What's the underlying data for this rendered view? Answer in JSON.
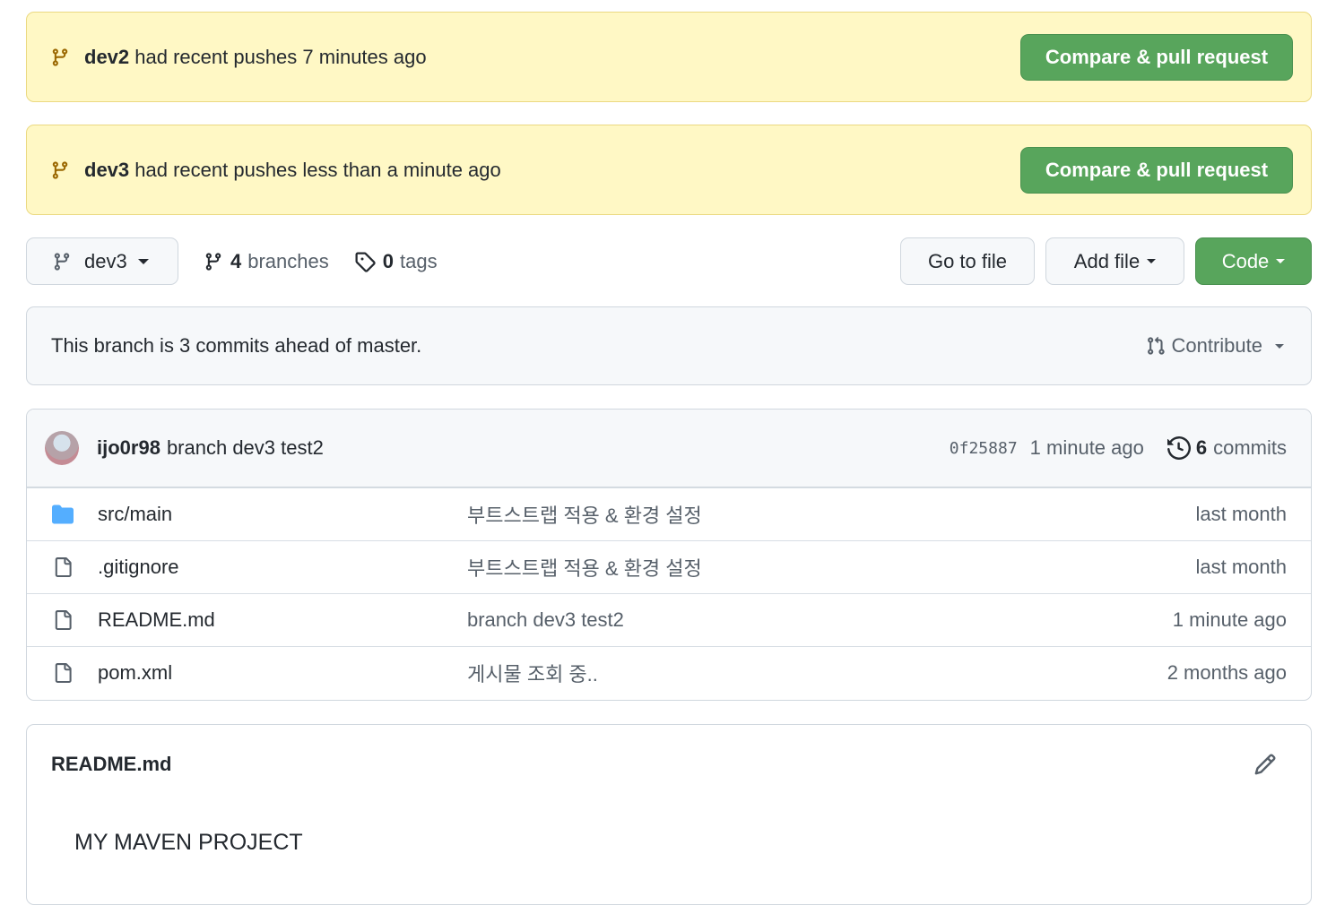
{
  "banners": [
    {
      "branch": "dev2",
      "text": " had recent pushes 7 minutes ago",
      "button": "Compare & pull request"
    },
    {
      "branch": "dev3",
      "text": " had recent pushes less than a minute ago",
      "button": "Compare & pull request"
    }
  ],
  "toolbar": {
    "current_branch": "dev3",
    "branches_count": "4",
    "branches_label": "branches",
    "tags_count": "0",
    "tags_label": "tags",
    "go_to_file": "Go to file",
    "add_file": "Add file",
    "code": "Code"
  },
  "ahead": {
    "text": "This branch is 3 commits ahead of master.",
    "contribute": "Contribute"
  },
  "latest_commit": {
    "author": "ijo0r98",
    "message": "branch dev3 test2",
    "sha": "0f25887",
    "time": "1 minute ago",
    "commits_count": "6",
    "commits_label": "commits"
  },
  "files": [
    {
      "type": "folder",
      "name": "src/main",
      "message": "부트스트랩 적용 & 환경 설정",
      "age": "last month"
    },
    {
      "type": "file",
      "name": ".gitignore",
      "message": "부트스트랩 적용 & 환경 설정",
      "age": "last month"
    },
    {
      "type": "file",
      "name": "README.md",
      "message": "branch dev3 test2",
      "age": "1 minute ago"
    },
    {
      "type": "file",
      "name": "pom.xml",
      "message": "게시물 조회 중..",
      "age": "2 months ago"
    }
  ],
  "readme": {
    "title": "README.md",
    "content": "MY MAVEN PROJECT"
  },
  "colors": {
    "banner_bg": "#fff8c5",
    "green_button": "#58a55c",
    "folder_icon": "#54aeff"
  }
}
